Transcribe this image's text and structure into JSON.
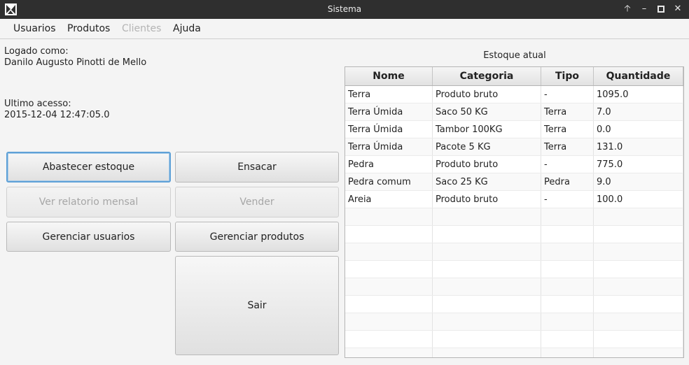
{
  "window": {
    "title": "Sistema"
  },
  "menu": [
    "Usuarios",
    "Produtos",
    "Clientes",
    "Ajuda"
  ],
  "session": {
    "logged_label": "Logado como:",
    "user_name": "Danilo Augusto Pinotti de Mello",
    "last_access_label": "Ultimo acesso:",
    "last_access": "2015-12-04 12:47:05.0"
  },
  "buttons": {
    "abastecer": "Abastecer estoque",
    "ensacar": "Ensacar",
    "relatorio": "Ver relatorio mensal",
    "vender": "Vender",
    "gerenciar_usuarios": "Gerenciar usuarios",
    "gerenciar_produtos": "Gerenciar produtos",
    "sair": "Sair"
  },
  "table": {
    "title": "Estoque atual",
    "headers": [
      "Nome",
      "Categoria",
      "Tipo",
      "Quantidade"
    ],
    "rows": [
      [
        "Terra",
        "Produto bruto",
        "-",
        "1095.0"
      ],
      [
        "Terra Úmida",
        "Saco 50 KG",
        "Terra",
        "7.0"
      ],
      [
        "Terra Úmida",
        "Tambor 100KG",
        "Terra",
        "0.0"
      ],
      [
        "Terra Úmida",
        "Pacote 5 KG",
        "Terra",
        "131.0"
      ],
      [
        "Pedra",
        "Produto bruto",
        "-",
        "775.0"
      ],
      [
        "Pedra comum",
        "Saco 25 KG",
        "Pedra",
        "9.0"
      ],
      [
        "Areia",
        "Produto bruto",
        "-",
        "100.0"
      ]
    ]
  }
}
